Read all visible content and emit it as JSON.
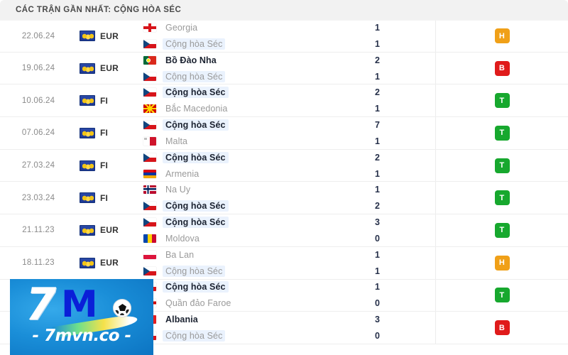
{
  "header": {
    "title": "CÁC TRẬN GẦN NHẤT: CỘNG HÒA SÉC"
  },
  "colors": {
    "win": "#17a82e",
    "draw": "#f0a018",
    "loss": "#e01b1b",
    "header_bg": "#f2f2f2",
    "highlight_bg": "#eaf2fd"
  },
  "focus_team": "Cộng hòa Séc",
  "legend": {
    "win_label": "T",
    "draw_label": "H",
    "loss_label": "B"
  },
  "matches": [
    {
      "date": "22.06.24",
      "competition": "EUR",
      "competition_icon": "uefa-euro-badge-icon",
      "home": {
        "name": "Georgia",
        "flag": "flag-georgia",
        "score": "1",
        "winner": false,
        "focus": false
      },
      "away": {
        "name": "Cộng hòa Séc",
        "flag": "flag-czech-republic",
        "score": "1",
        "winner": false,
        "focus": true
      },
      "result": "H",
      "result_class": "D"
    },
    {
      "date": "19.06.24",
      "competition": "EUR",
      "competition_icon": "uefa-euro-badge-icon",
      "home": {
        "name": "Bồ Đào Nha",
        "flag": "flag-portugal",
        "score": "2",
        "winner": true,
        "focus": false
      },
      "away": {
        "name": "Cộng hòa Séc",
        "flag": "flag-czech-republic",
        "score": "1",
        "winner": false,
        "focus": true
      },
      "result": "B",
      "result_class": "L"
    },
    {
      "date": "10.06.24",
      "competition": "FI",
      "competition_icon": "uefa-euro-badge-icon",
      "home": {
        "name": "Cộng hòa Séc",
        "flag": "flag-czech-republic",
        "score": "2",
        "winner": true,
        "focus": true
      },
      "away": {
        "name": "Bắc Macedonia",
        "flag": "flag-north-macedonia",
        "score": "1",
        "winner": false,
        "focus": false
      },
      "result": "T",
      "result_class": "W"
    },
    {
      "date": "07.06.24",
      "competition": "FI",
      "competition_icon": "uefa-euro-badge-icon",
      "home": {
        "name": "Cộng hòa Séc",
        "flag": "flag-czech-republic",
        "score": "7",
        "winner": true,
        "focus": true
      },
      "away": {
        "name": "Malta",
        "flag": "flag-malta",
        "score": "1",
        "winner": false,
        "focus": false
      },
      "result": "T",
      "result_class": "W"
    },
    {
      "date": "27.03.24",
      "competition": "FI",
      "competition_icon": "uefa-euro-badge-icon",
      "home": {
        "name": "Cộng hòa Séc",
        "flag": "flag-czech-republic",
        "score": "2",
        "winner": true,
        "focus": true
      },
      "away": {
        "name": "Armenia",
        "flag": "flag-armenia",
        "score": "1",
        "winner": false,
        "focus": false
      },
      "result": "T",
      "result_class": "W"
    },
    {
      "date": "23.03.24",
      "competition": "FI",
      "competition_icon": "uefa-euro-badge-icon",
      "home": {
        "name": "Na Uy",
        "flag": "flag-norway",
        "score": "1",
        "winner": false,
        "focus": false
      },
      "away": {
        "name": "Cộng hòa Séc",
        "flag": "flag-czech-republic",
        "score": "2",
        "winner": true,
        "focus": true
      },
      "result": "T",
      "result_class": "W"
    },
    {
      "date": "21.11.23",
      "competition": "EUR",
      "competition_icon": "uefa-euro-badge-icon",
      "home": {
        "name": "Cộng hòa Séc",
        "flag": "flag-czech-republic",
        "score": "3",
        "winner": true,
        "focus": true
      },
      "away": {
        "name": "Moldova",
        "flag": "flag-moldova",
        "score": "0",
        "winner": false,
        "focus": false
      },
      "result": "T",
      "result_class": "W"
    },
    {
      "date": "18.11.23",
      "competition": "EUR",
      "competition_icon": "uefa-euro-badge-icon",
      "home": {
        "name": "Ba Lan",
        "flag": "flag-poland",
        "score": "1",
        "winner": false,
        "focus": false
      },
      "away": {
        "name": "Cộng hòa Séc",
        "flag": "flag-czech-republic",
        "score": "1",
        "winner": false,
        "focus": true
      },
      "result": "H",
      "result_class": "D"
    },
    {
      "date": "",
      "competition": "",
      "competition_icon": "",
      "home": {
        "name": "Cộng hòa Séc",
        "flag": "flag-czech-republic",
        "score": "1",
        "winner": true,
        "focus": true
      },
      "away": {
        "name": "Quần đảo Faroe",
        "flag": "flag-faroe-islands",
        "score": "0",
        "winner": false,
        "focus": false
      },
      "result": "T",
      "result_class": "W"
    },
    {
      "date": "",
      "competition": "",
      "competition_icon": "",
      "home": {
        "name": "Albania",
        "flag": "flag-albania",
        "score": "3",
        "winner": true,
        "focus": false
      },
      "away": {
        "name": "Cộng hòa Séc",
        "flag": "flag-czech-republic",
        "score": "0",
        "winner": false,
        "focus": true
      },
      "result": "B",
      "result_class": "L"
    }
  ],
  "watermark": {
    "logo_seven": "7",
    "logo_m": "M",
    "url": "- 7mvn.co -"
  }
}
